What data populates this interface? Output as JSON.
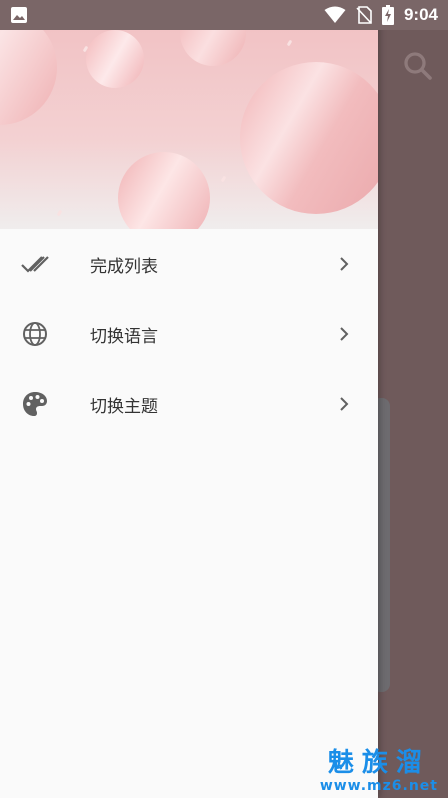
{
  "status_bar": {
    "time": "9:04",
    "icons": [
      "image-notification-icon",
      "wifi-icon",
      "no-sim-icon",
      "battery-charging-icon"
    ]
  },
  "background_app": {
    "icons": [
      "search-icon"
    ]
  },
  "drawer": {
    "menu": [
      {
        "label": "完成列表",
        "icon": "double-check-icon"
      },
      {
        "label": "切换语言",
        "icon": "globe-icon"
      },
      {
        "label": "切换主题",
        "icon": "palette-icon"
      }
    ]
  },
  "watermark": {
    "title": "魅族溜",
    "url": "www.mz6.net"
  },
  "colors": {
    "scrim": "#6f5a5b",
    "drawer_bg": "#fafafa",
    "header_pink": "#f2c3c5",
    "icon_gray": "#616161",
    "watermark_blue": "#1b8ee8"
  }
}
